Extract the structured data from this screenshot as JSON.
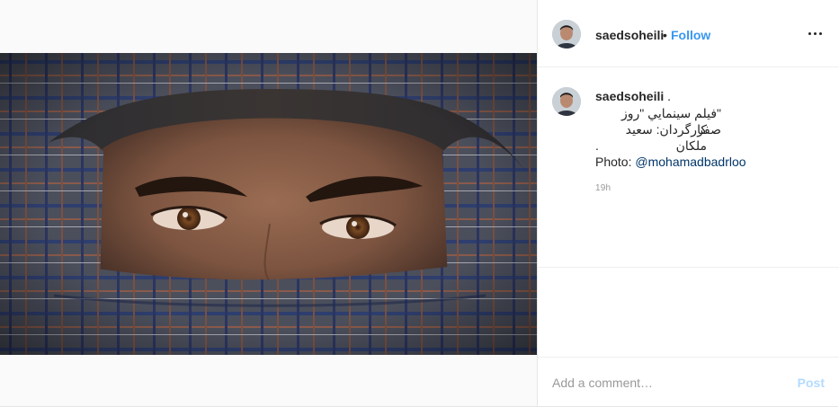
{
  "post": {
    "username": "saedsoheili",
    "follow_label": "Follow",
    "separator": "•",
    "more_icon": "more-horizontal-icon"
  },
  "caption": {
    "username": "saedsoheili",
    "username_suffix": " .",
    "line1": "\"فیلم سینمایي \"روز صفر",
    "line2": "کارگردان: سعید ملکان",
    "line3": ".",
    "photo_prefix": "Photo: ",
    "photo_mention": "@mohamadbadrloo",
    "time": "19h"
  },
  "comment": {
    "placeholder": "Add a comment…",
    "post_label": "Post"
  },
  "colors": {
    "link_blue": "#3897f0",
    "mention_blue": "#003569",
    "post_disabled": "#b3dbff",
    "border": "#efefef"
  }
}
